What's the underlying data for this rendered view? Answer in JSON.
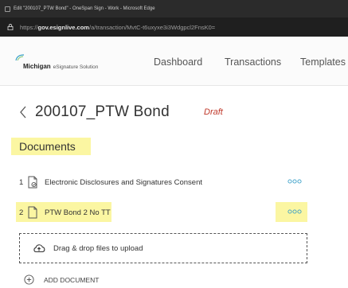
{
  "window": {
    "title": "Edit \"200107_PTW Bond\" - OneSpan Sign - Work - Microsoft Edge"
  },
  "address": {
    "prefix": "https://",
    "domain": "gov.esignlive.com",
    "path": "/a/transaction/MvtC-t6uxyxe3i3Wdgpcl2FnsK0="
  },
  "brand": {
    "bold": "Michigan",
    "rest": "eSignature Solution"
  },
  "nav": {
    "dashboard": "Dashboard",
    "transactions": "Transactions",
    "templates": "Templates"
  },
  "transaction": {
    "title": "200107_PTW Bond",
    "status": "Draft"
  },
  "documents": {
    "heading": "Documents",
    "items": [
      {
        "index": "1",
        "name": "Electronic Disclosures and Signatures Consent"
      },
      {
        "index": "2",
        "name": "PTW Bond 2 No TT"
      }
    ],
    "more_label": "ooo",
    "upload_text": "Drag & drop files to upload",
    "add_label": "ADD DOCUMENT"
  },
  "colors": {
    "highlight": "#fbf6a2",
    "draft": "#c0392b",
    "accent": "#3aa0c8"
  }
}
